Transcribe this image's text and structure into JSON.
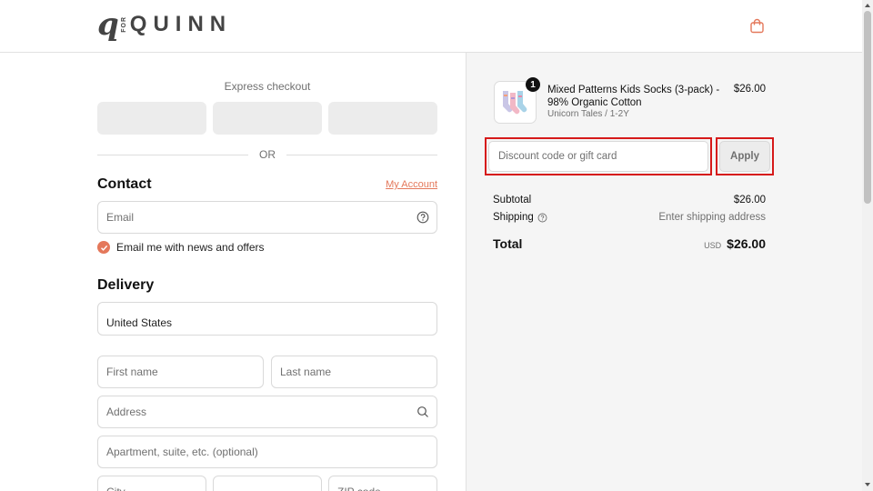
{
  "header": {
    "logo_mark": "q",
    "logo_for": "FOR",
    "logo_text": "QUINN",
    "cart_icon": "shopping-bag-icon",
    "accent_color": "#e4785b"
  },
  "express": {
    "title": "Express checkout",
    "or_label": "OR"
  },
  "contact": {
    "title": "Contact",
    "account_link": "My Account",
    "email_placeholder": "Email",
    "newsletter_label": "Email me with news and offers",
    "newsletter_checked": true
  },
  "delivery": {
    "title": "Delivery",
    "country_value": "United States",
    "first_name_placeholder": "First name",
    "last_name_placeholder": "Last name",
    "address_placeholder": "Address",
    "apartment_placeholder": "Apartment, suite, etc. (optional)",
    "city_placeholder": "City",
    "zip_placeholder": "ZIP code"
  },
  "order": {
    "item": {
      "title": "Mixed Patterns Kids Socks (3-pack) - 98% Organic Cotton",
      "variant": "Unicorn Tales / 1-2Y",
      "price": "$26.00",
      "quantity": "1"
    },
    "discount_placeholder": "Discount code or gift card",
    "apply_label": "Apply",
    "subtotal_label": "Subtotal",
    "subtotal_value": "$26.00",
    "shipping_label": "Shipping",
    "shipping_value": "Enter shipping address",
    "total_label": "Total",
    "currency": "USD",
    "total_value": "$26.00"
  }
}
